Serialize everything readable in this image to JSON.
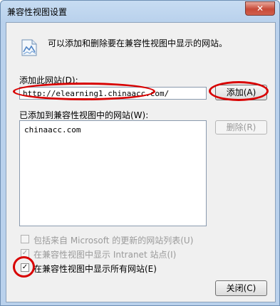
{
  "window": {
    "title": "兼容性视图设置",
    "close_symbol": "✕"
  },
  "intro": {
    "icon": "compat-view-icon",
    "text": "可以添加和删除要在兼容性视图中显示的网站。"
  },
  "add_site": {
    "label": "添加此网站(D):",
    "value": "http://elearning1.chinaacc.com/",
    "add_button": "添加(A)"
  },
  "site_list": {
    "label": "已添加到兼容性视图中的网站(W):",
    "items": [
      "chinaacc.com"
    ],
    "remove_button": "删除(R)"
  },
  "options": [
    {
      "label": "包括来自 Microsoft 的更新的网站列表(U)",
      "checked": false,
      "enabled": false
    },
    {
      "label": "在兼容性视图中显示 Intranet 站点(I)",
      "checked": true,
      "enabled": false
    },
    {
      "label": "在兼容性视图中显示所有网站(E)",
      "checked": true,
      "enabled": true
    }
  ],
  "close_button": "关闭(C)",
  "highlight_color": "#d80000"
}
